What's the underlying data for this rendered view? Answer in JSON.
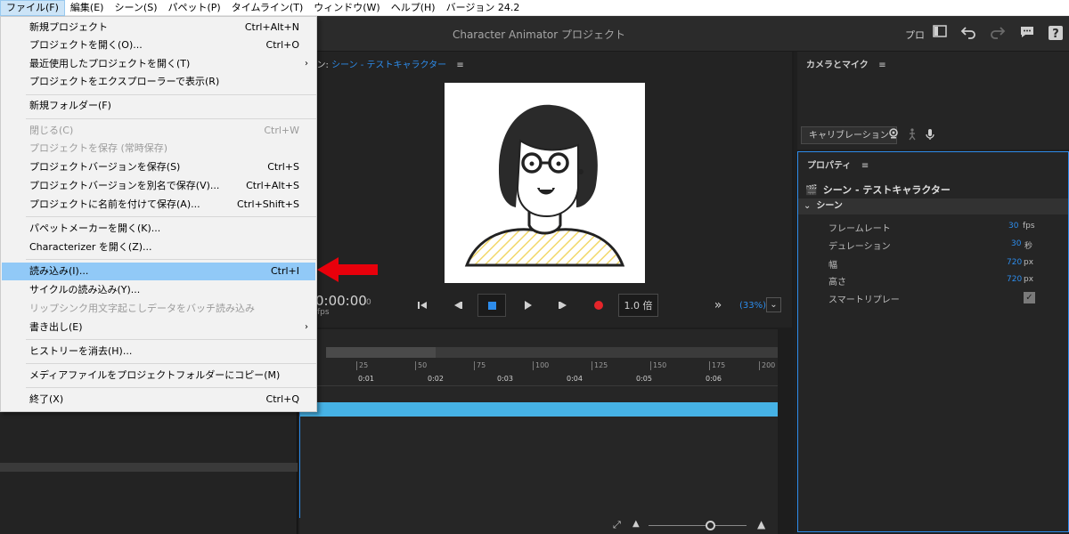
{
  "menubar": {
    "items": [
      "ファイル(F)",
      "編集(E)",
      "シーン(S)",
      "パペット(P)",
      "タイムライン(T)",
      "ウィンドウ(W)",
      "ヘルプ(H)",
      "バージョン 24.2"
    ]
  },
  "header": {
    "title": "Character Animator プロジェクト",
    "pro_label": "プロ"
  },
  "file_menu": {
    "items": [
      {
        "label": "新規プロジェクト",
        "shortcut": "Ctrl+Alt+N"
      },
      {
        "label": "プロジェクトを開く(O)...",
        "shortcut": "Ctrl+O"
      },
      {
        "label": "最近使用したプロジェクトを開く(T)",
        "shortcut": "›"
      },
      {
        "label": "プロジェクトをエクスプローラーで表示(R)",
        "shortcut": ""
      },
      {
        "label": "新規フォルダー(F)",
        "shortcut": ""
      },
      {
        "label": "閉じる(C)",
        "shortcut": "Ctrl+W"
      },
      {
        "label": "プロジェクトを保存 (常時保存)",
        "shortcut": ""
      },
      {
        "label": "プロジェクトバージョンを保存(S)",
        "shortcut": "Ctrl+S"
      },
      {
        "label": "プロジェクトバージョンを別名で保存(V)...",
        "shortcut": "Ctrl+Alt+S"
      },
      {
        "label": "プロジェクトに名前を付けて保存(A)...",
        "shortcut": "Ctrl+Shift+S"
      },
      {
        "label": "パペットメーカーを開く(K)...",
        "shortcut": ""
      },
      {
        "label": "Characterizer を開く(Z)...",
        "shortcut": ""
      },
      {
        "label": "読み込み(I)...",
        "shortcut": "Ctrl+I"
      },
      {
        "label": "サイクルの読み込み(Y)...",
        "shortcut": ""
      },
      {
        "label": "リップシンク用文字起こしデータをバッチ読み込み",
        "shortcut": ""
      },
      {
        "label": "書き出し(E)",
        "shortcut": "›"
      },
      {
        "label": "ヒストリーを消去(H)...",
        "shortcut": ""
      },
      {
        "label": "メディアファイルをプロジェクトフォルダーにコピー(M)",
        "shortcut": ""
      },
      {
        "label": "終了(X)",
        "shortcut": "Ctrl+Q"
      }
    ]
  },
  "scene": {
    "tab_prefix": "シーン: ",
    "tab_name": "シーン - テストキャラクター",
    "timecode": "0:00:00",
    "timecode_frame": "0",
    "fps_label": "fps",
    "speed": "1.0 倍",
    "zoom": "(33%)"
  },
  "timeline": {
    "ruler_numbers": [
      "25",
      "50",
      "75",
      "100",
      "125",
      "150",
      "175",
      "200"
    ],
    "ruler_times": [
      "0:01",
      "0:02",
      "0:03",
      "0:04",
      "0:05",
      "0:06"
    ]
  },
  "camera": {
    "tab": "カメラとマイク",
    "calibration": "キャリブレーション"
  },
  "properties": {
    "tab": "プロパティ",
    "scene_title": "シーン - テストキャラクター",
    "section": "シーン",
    "rows": [
      {
        "label": "フレームレート",
        "value": "30",
        "unit": "fps"
      },
      {
        "label": "デュレーション",
        "value": "30",
        "unit": "秒"
      },
      {
        "label": "幅",
        "value": "720",
        "unit": "px"
      },
      {
        "label": "高さ",
        "value": "720",
        "unit": "px"
      },
      {
        "label": "スマートリプレー",
        "value": "",
        "unit": ""
      }
    ]
  },
  "colors": {
    "accent": "#2d8ceb",
    "highlight": "#91c9f7",
    "arrow": "#e8000b"
  }
}
